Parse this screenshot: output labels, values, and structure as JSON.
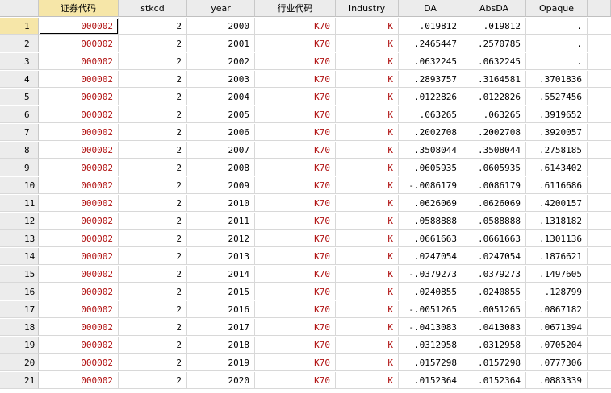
{
  "columns": [
    "证券代码",
    "stkcd",
    "year",
    "行业代码",
    "Industry",
    "DA",
    "AbsDA",
    "Opaque"
  ],
  "colors": {
    "string_text": "#b01010",
    "header_bg": "#ececec",
    "selected_bg": "#f6e6a8",
    "grid_line": "#d8d8d8"
  },
  "rows": [
    {
      "n": "1",
      "code": "000002",
      "stkcd": "2",
      "year": "2000",
      "ind": "K70",
      "industry": "K",
      "da": ".019812",
      "absda": ".019812",
      "opaque": "."
    },
    {
      "n": "2",
      "code": "000002",
      "stkcd": "2",
      "year": "2001",
      "ind": "K70",
      "industry": "K",
      "da": ".2465447",
      "absda": ".2570785",
      "opaque": "."
    },
    {
      "n": "3",
      "code": "000002",
      "stkcd": "2",
      "year": "2002",
      "ind": "K70",
      "industry": "K",
      "da": ".0632245",
      "absda": ".0632245",
      "opaque": "."
    },
    {
      "n": "4",
      "code": "000002",
      "stkcd": "2",
      "year": "2003",
      "ind": "K70",
      "industry": "K",
      "da": ".2893757",
      "absda": ".3164581",
      "opaque": ".3701836"
    },
    {
      "n": "5",
      "code": "000002",
      "stkcd": "2",
      "year": "2004",
      "ind": "K70",
      "industry": "K",
      "da": ".0122826",
      "absda": ".0122826",
      "opaque": ".5527456"
    },
    {
      "n": "6",
      "code": "000002",
      "stkcd": "2",
      "year": "2005",
      "ind": "K70",
      "industry": "K",
      "da": ".063265",
      "absda": ".063265",
      "opaque": ".3919652"
    },
    {
      "n": "7",
      "code": "000002",
      "stkcd": "2",
      "year": "2006",
      "ind": "K70",
      "industry": "K",
      "da": ".2002708",
      "absda": ".2002708",
      "opaque": ".3920057"
    },
    {
      "n": "8",
      "code": "000002",
      "stkcd": "2",
      "year": "2007",
      "ind": "K70",
      "industry": "K",
      "da": ".3508044",
      "absda": ".3508044",
      "opaque": ".2758185"
    },
    {
      "n": "9",
      "code": "000002",
      "stkcd": "2",
      "year": "2008",
      "ind": "K70",
      "industry": "K",
      "da": ".0605935",
      "absda": ".0605935",
      "opaque": ".6143402"
    },
    {
      "n": "10",
      "code": "000002",
      "stkcd": "2",
      "year": "2009",
      "ind": "K70",
      "industry": "K",
      "da": "-.0086179",
      "absda": ".0086179",
      "opaque": ".6116686"
    },
    {
      "n": "11",
      "code": "000002",
      "stkcd": "2",
      "year": "2010",
      "ind": "K70",
      "industry": "K",
      "da": ".0626069",
      "absda": ".0626069",
      "opaque": ".4200157"
    },
    {
      "n": "12",
      "code": "000002",
      "stkcd": "2",
      "year": "2011",
      "ind": "K70",
      "industry": "K",
      "da": ".0588888",
      "absda": ".0588888",
      "opaque": ".1318182"
    },
    {
      "n": "13",
      "code": "000002",
      "stkcd": "2",
      "year": "2012",
      "ind": "K70",
      "industry": "K",
      "da": ".0661663",
      "absda": ".0661663",
      "opaque": ".1301136"
    },
    {
      "n": "14",
      "code": "000002",
      "stkcd": "2",
      "year": "2013",
      "ind": "K70",
      "industry": "K",
      "da": ".0247054",
      "absda": ".0247054",
      "opaque": ".1876621"
    },
    {
      "n": "15",
      "code": "000002",
      "stkcd": "2",
      "year": "2014",
      "ind": "K70",
      "industry": "K",
      "da": "-.0379273",
      "absda": ".0379273",
      "opaque": ".1497605"
    },
    {
      "n": "16",
      "code": "000002",
      "stkcd": "2",
      "year": "2015",
      "ind": "K70",
      "industry": "K",
      "da": ".0240855",
      "absda": ".0240855",
      "opaque": ".128799"
    },
    {
      "n": "17",
      "code": "000002",
      "stkcd": "2",
      "year": "2016",
      "ind": "K70",
      "industry": "K",
      "da": "-.0051265",
      "absda": ".0051265",
      "opaque": ".0867182"
    },
    {
      "n": "18",
      "code": "000002",
      "stkcd": "2",
      "year": "2017",
      "ind": "K70",
      "industry": "K",
      "da": "-.0413083",
      "absda": ".0413083",
      "opaque": ".0671394"
    },
    {
      "n": "19",
      "code": "000002",
      "stkcd": "2",
      "year": "2018",
      "ind": "K70",
      "industry": "K",
      "da": ".0312958",
      "absda": ".0312958",
      "opaque": ".0705204"
    },
    {
      "n": "20",
      "code": "000002",
      "stkcd": "2",
      "year": "2019",
      "ind": "K70",
      "industry": "K",
      "da": ".0157298",
      "absda": ".0157298",
      "opaque": ".0777306"
    },
    {
      "n": "21",
      "code": "000002",
      "stkcd": "2",
      "year": "2020",
      "ind": "K70",
      "industry": "K",
      "da": ".0152364",
      "absda": ".0152364",
      "opaque": ".0883339"
    }
  ]
}
